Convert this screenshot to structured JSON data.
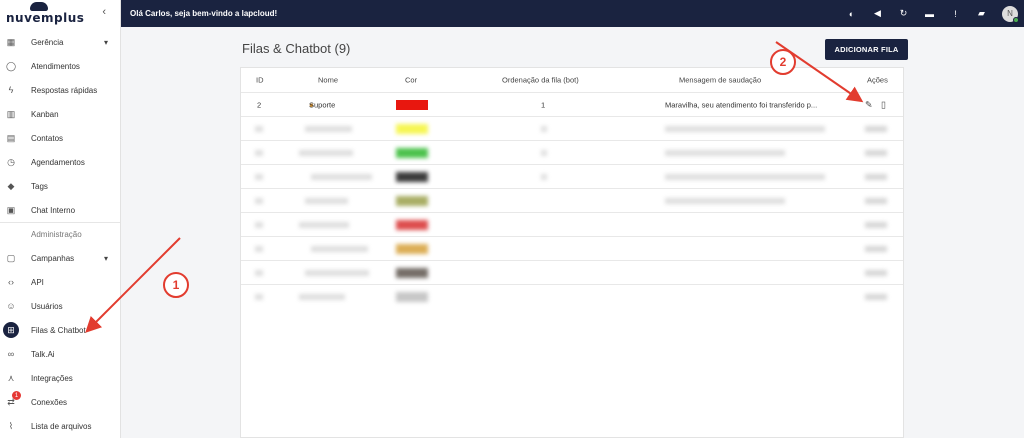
{
  "brand": {
    "logo_text": "nuvemplus",
    "collapse_icon": "chevron-left-icon"
  },
  "sidebar": {
    "items_top": [
      {
        "label": "Gerência",
        "icon": "dashboard-icon",
        "glyph": "▦",
        "expand": "▾"
      },
      {
        "label": "Atendimentos",
        "icon": "whatsapp-icon",
        "glyph": "◯"
      },
      {
        "label": "Respostas rápidas",
        "icon": "bolt-icon",
        "glyph": "ϟ"
      },
      {
        "label": "Kanban",
        "icon": "kanban-icon",
        "glyph": "▥"
      },
      {
        "label": "Contatos",
        "icon": "contacts-icon",
        "glyph": "▤"
      },
      {
        "label": "Agendamentos",
        "icon": "clock-icon",
        "glyph": "◷"
      },
      {
        "label": "Tags",
        "icon": "tag-icon",
        "glyph": "◆"
      },
      {
        "label": "Chat Interno",
        "icon": "chat-icon",
        "glyph": "▣"
      }
    ],
    "section_label": "Administração",
    "items_admin": [
      {
        "label": "Campanhas",
        "icon": "calendar-icon",
        "glyph": "▢",
        "expand": "▾"
      },
      {
        "label": "API",
        "icon": "code-icon",
        "glyph": "‹›"
      },
      {
        "label": "Usuários",
        "icon": "users-icon",
        "glyph": "☺"
      },
      {
        "label": "Filas & Chatbot",
        "icon": "flow-icon",
        "glyph": "⊞"
      },
      {
        "label": "Talk.Ai",
        "icon": "infinity-icon",
        "glyph": "∞"
      },
      {
        "label": "Integrações",
        "icon": "integration-icon",
        "glyph": "⋏"
      },
      {
        "label": "Conexões",
        "icon": "connections-icon",
        "glyph": "⇄",
        "badge": "1"
      },
      {
        "label": "Lista de arquivos",
        "icon": "paperclip-icon",
        "glyph": "⌇"
      }
    ]
  },
  "topbar": {
    "welcome": "Olá Carlos, seja bem-vindo a lapcloud!",
    "icons": [
      {
        "name": "theme-icon",
        "glyph": "◐"
      },
      {
        "name": "volume-icon",
        "glyph": "◀"
      },
      {
        "name": "refresh-icon",
        "glyph": "↻"
      },
      {
        "name": "message-icon",
        "glyph": "▬"
      },
      {
        "name": "alert-icon",
        "glyph": "!"
      },
      {
        "name": "chat-icon",
        "glyph": "▰"
      }
    ],
    "avatar_initial": "N"
  },
  "main": {
    "title": "Filas & Chatbot (9)",
    "add_button": "ADICIONAR FILA",
    "columns": [
      "ID",
      "Nome",
      "Cor",
      "Ordenação da fila (bot)",
      "Mensagem de saudação",
      "Ações"
    ],
    "rows": [
      {
        "id": "2",
        "name": "Suporte",
        "color": "#e8170f",
        "order": "1",
        "greeting": "Maravilha, seu atendimento foi transferido p...",
        "blurred": false
      },
      {
        "color": "#f5f535",
        "blurred": true
      },
      {
        "color": "#2fb82f",
        "blurred": true
      },
      {
        "color": "#1a1a1a",
        "blurred": true
      },
      {
        "color": "#9aa04a",
        "blurred": true
      },
      {
        "color": "#d83030",
        "blurred": true
      },
      {
        "color": "#d6a038",
        "blurred": true
      },
      {
        "color": "#5e554e",
        "blurred": true
      },
      {
        "color": "#bdbdbd",
        "blurred": true
      }
    ]
  },
  "annotations": {
    "marker_1": "1",
    "marker_2": "2",
    "color": "#e23c2f"
  }
}
